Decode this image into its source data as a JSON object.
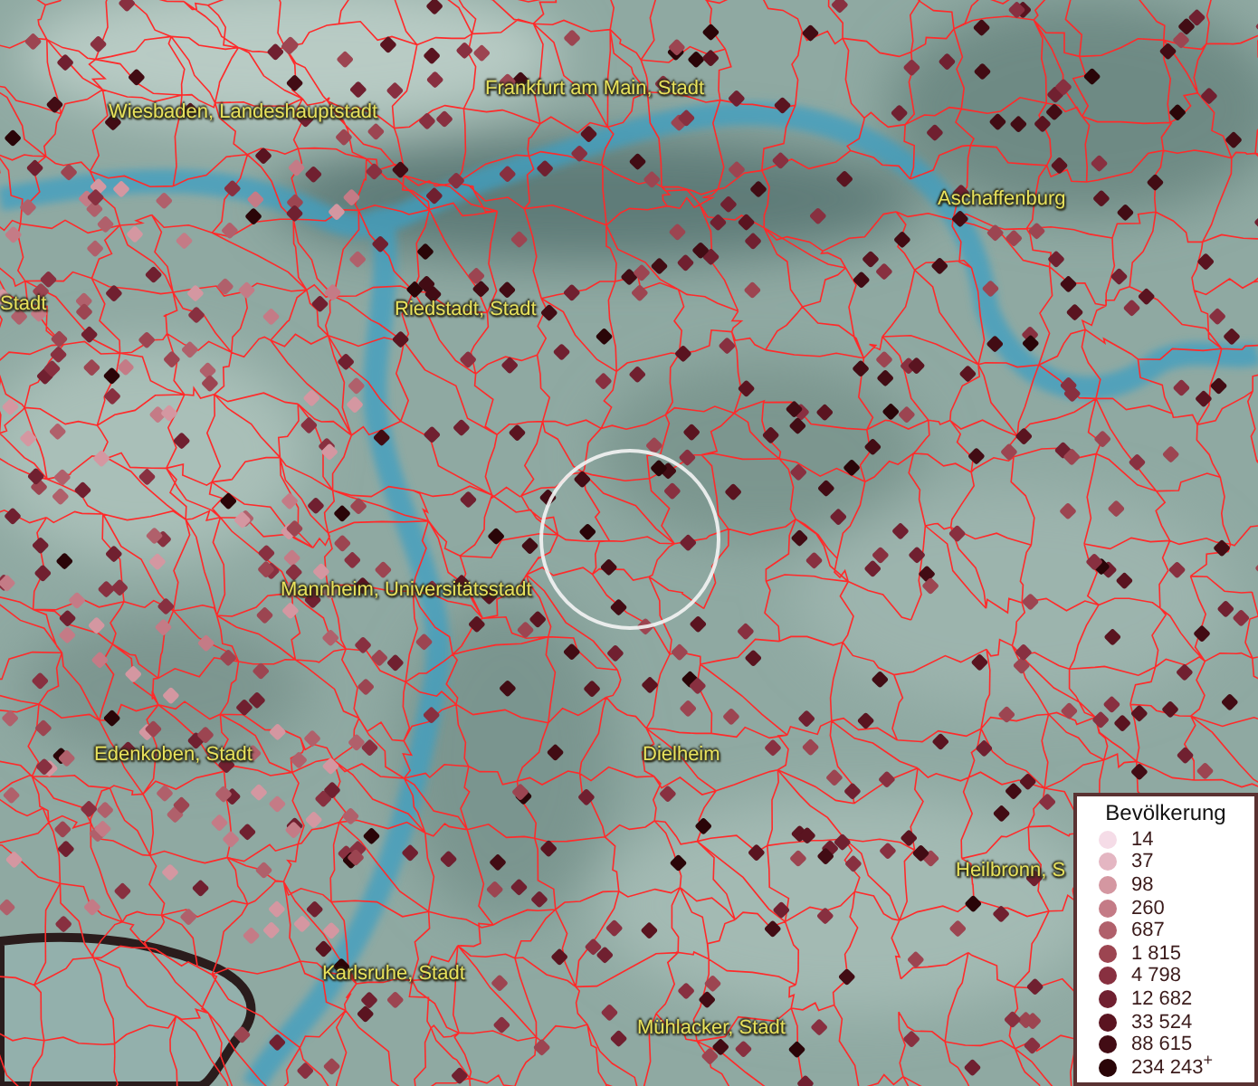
{
  "map": {
    "labels": [
      {
        "text": "Wiesbaden, Landeshauptstadt"
      },
      {
        "text": "Frankfurt am Main, Stadt"
      },
      {
        "text": "Aschaffenburg"
      },
      {
        "text": "Stadt"
      },
      {
        "text": "Riedstadt, Stadt"
      },
      {
        "text": "Mannheim, Universitätsstadt"
      },
      {
        "text": "Edenkoben, Stadt"
      },
      {
        "text": "Dielheim"
      },
      {
        "text": "Heilbronn, S"
      },
      {
        "text": "Karlsruhe, Stadt"
      },
      {
        "text": "Mühlacker, Stadt"
      }
    ]
  },
  "legend": {
    "title": "Bevölkerung",
    "classes": [
      {
        "label": "14",
        "color": "#f5dce7"
      },
      {
        "label": "37",
        "color": "#e4b6c2"
      },
      {
        "label": "98",
        "color": "#d497a1"
      },
      {
        "label": "260",
        "color": "#c47b86"
      },
      {
        "label": "687",
        "color": "#b0606b"
      },
      {
        "label": "1 815",
        "color": "#9c4551"
      },
      {
        "label": "4 798",
        "color": "#883040"
      },
      {
        "label": "12 682",
        "color": "#702030"
      },
      {
        "label": "33 524",
        "color": "#5a1420"
      },
      {
        "label": "88 615",
        "color": "#420c14"
      },
      {
        "label": "234 243$^{+}$",
        "color": "#2a0508"
      }
    ]
  }
}
